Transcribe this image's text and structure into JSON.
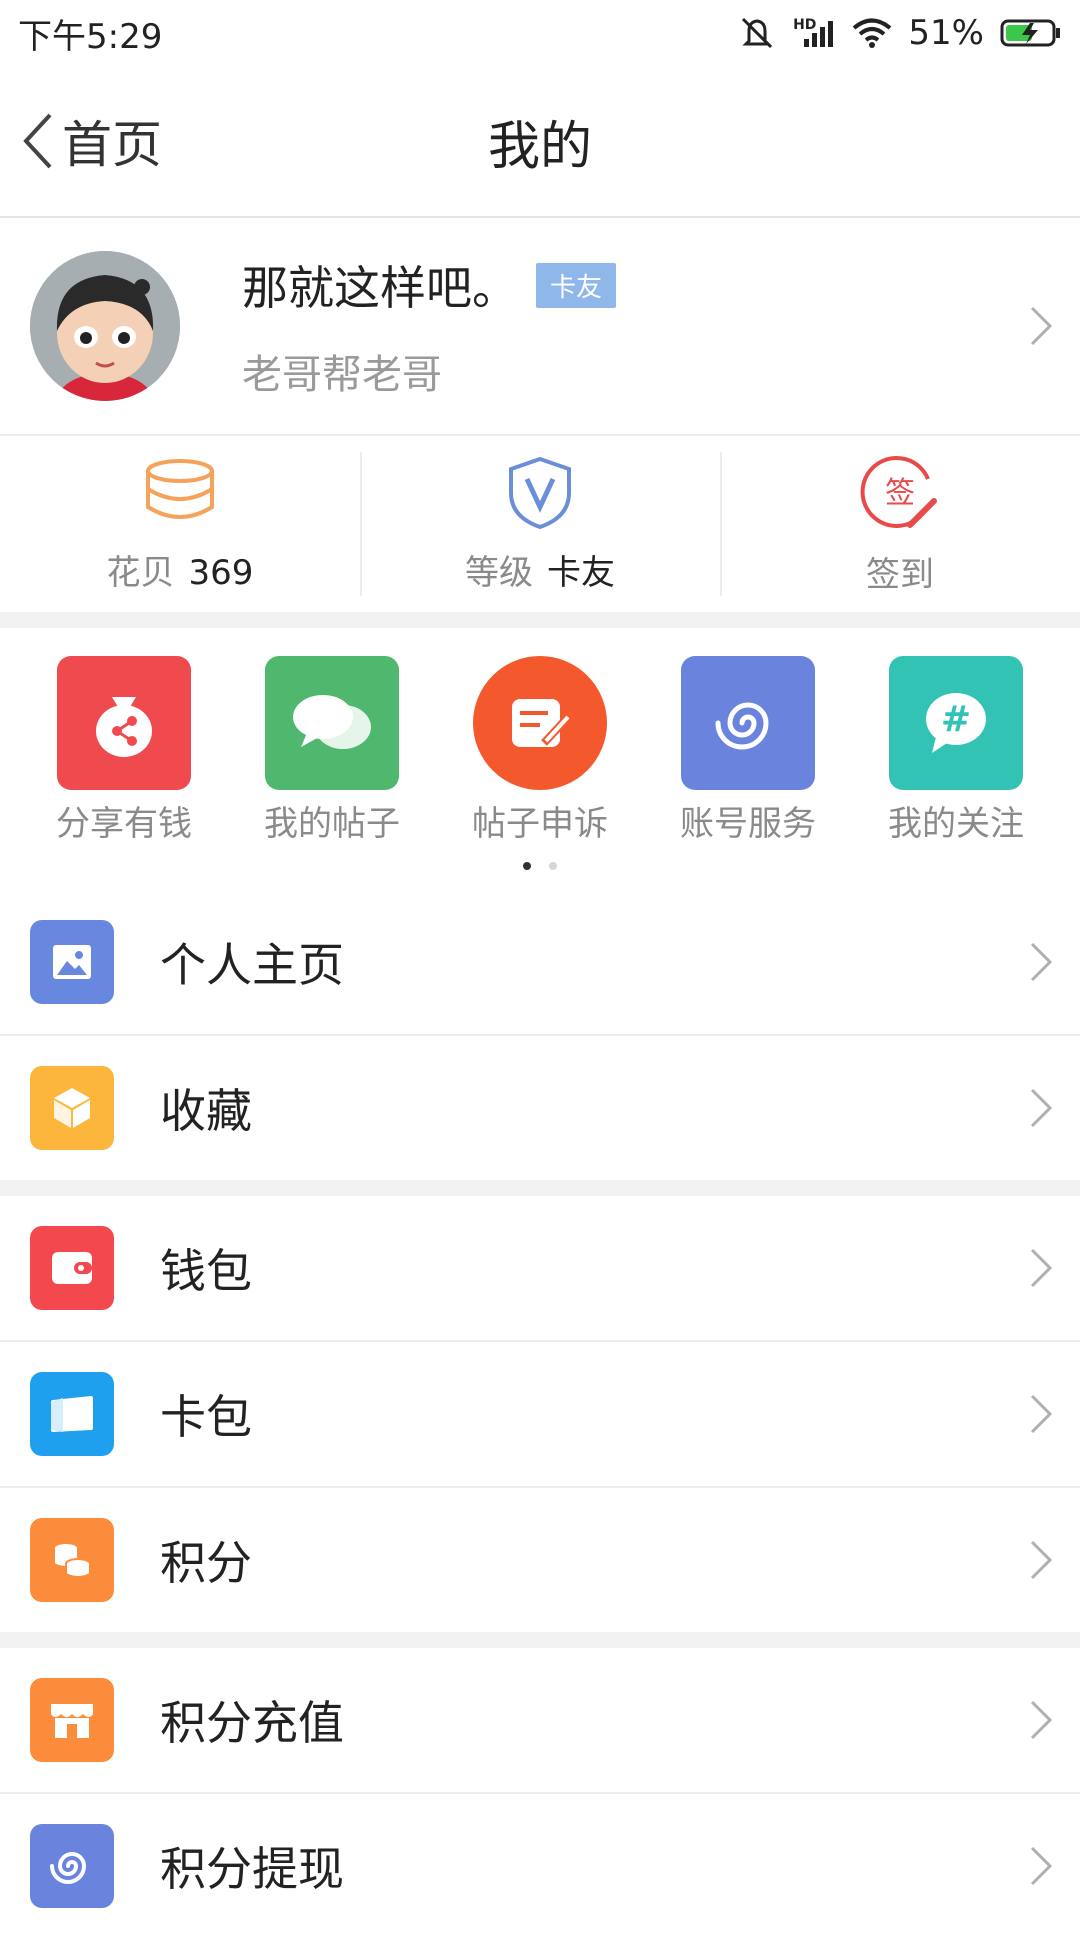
{
  "status_bar": {
    "time": "下午5:29",
    "battery": "51%",
    "network": "HD"
  },
  "nav": {
    "back_label": "首页",
    "title": "我的"
  },
  "profile": {
    "name": "那就这样吧。",
    "badge": "卡友",
    "subtitle": "老哥帮老哥"
  },
  "stats": [
    {
      "label": "花贝",
      "value": "369",
      "icon": "coins-stack-icon",
      "color": "#f5a25a"
    },
    {
      "label": "等级",
      "value": "卡友",
      "icon": "shield-v-icon",
      "color": "#6a8fd8"
    },
    {
      "label": "签到",
      "value": "",
      "icon": "sign-in-icon",
      "color": "#e84a4a",
      "icon_text": "签"
    }
  ],
  "shortcuts": [
    {
      "label": "分享有钱",
      "icon": "money-bag-share-icon",
      "color": "#ef4b4f"
    },
    {
      "label": "我的帖子",
      "icon": "chat-bubbles-icon",
      "color": "#4fb86e"
    },
    {
      "label": "帖子申诉",
      "icon": "edit-note-icon",
      "color": "#f4592e"
    },
    {
      "label": "账号服务",
      "icon": "spiral-icon",
      "color": "#6a84de"
    },
    {
      "label": "我的关注",
      "icon": "hashtag-bubble-icon",
      "color": "#33c3b5",
      "icon_text": "#"
    }
  ],
  "pager": {
    "pages": 2,
    "active": 1
  },
  "menu_groups": [
    [
      {
        "label": "个人主页",
        "icon": "image-icon",
        "color": "#6788de"
      },
      {
        "label": "收藏",
        "icon": "box-icon",
        "color": "#fdb63c"
      }
    ],
    [
      {
        "label": "钱包",
        "icon": "wallet-icon",
        "color": "#f3484e"
      },
      {
        "label": "卡包",
        "icon": "card-icon",
        "color": "#1ea0ee"
      },
      {
        "label": "积分",
        "icon": "coins-icon",
        "color": "#fb8c3b"
      }
    ],
    [
      {
        "label": "积分充值",
        "icon": "store-icon",
        "color": "#fb8c3b"
      },
      {
        "label": "积分提现",
        "icon": "spiral-icon",
        "color": "#6a84de"
      }
    ]
  ]
}
